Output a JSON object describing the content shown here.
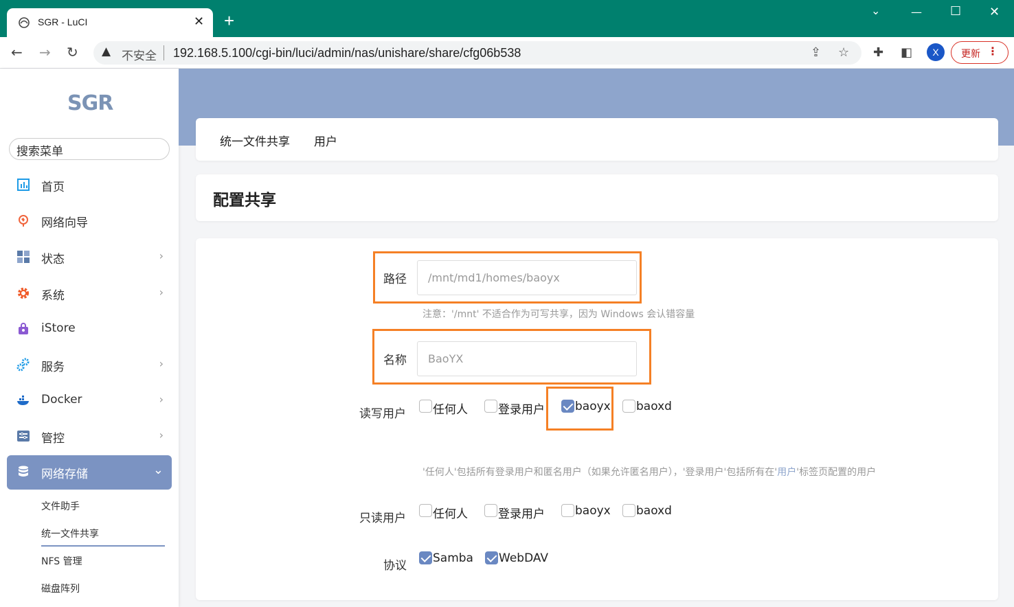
{
  "browser": {
    "tab_title": "SGR - LuCI",
    "insecure_label": "不安全",
    "url": "192.168.5.100/cgi-bin/luci/admin/nas/unishare/share/cfg06b538",
    "profile_initial": "X",
    "update_label": "更新"
  },
  "sidebar": {
    "logo": "SGR",
    "search_placeholder": "搜索菜单",
    "items": [
      {
        "label": "首页",
        "icon": "dashboard-icon",
        "color": "#1e9be6"
      },
      {
        "label": "网络向导",
        "icon": "globe-icon",
        "color": "#f0643c"
      },
      {
        "label": "状态",
        "icon": "status-grid-icon",
        "color": "#5a7aa8"
      },
      {
        "label": "系统",
        "icon": "gear-icon",
        "color": "#f05a28"
      },
      {
        "label": "iStore",
        "icon": "store-bag-icon",
        "color": "#8b5ad2"
      },
      {
        "label": "服务",
        "icon": "services-gears-icon",
        "color": "#1e9be6"
      },
      {
        "label": "Docker",
        "icon": "docker-whale-icon",
        "color": "#1e6bc8"
      },
      {
        "label": "管控",
        "icon": "control-panel-icon",
        "color": "#5a7aa8"
      },
      {
        "label": "网络存储",
        "icon": "storage-db-icon",
        "color": "#ffffff"
      }
    ],
    "sub_items": [
      "文件助手",
      "统一文件共享",
      "NFS 管理",
      "磁盘阵列"
    ]
  },
  "main": {
    "tabs": [
      "统一文件共享",
      "用户"
    ],
    "page_title": "配置共享",
    "form": {
      "path_label": "路径",
      "path_value": "/mnt/md1/homes/baoyx",
      "path_note": "注意：'/mnt' 不适合作为可写共享，因为 Windows 会认错容量",
      "name_label": "名称",
      "name_value": "BaoYX",
      "rw_label": "读写用户",
      "rw_options": [
        {
          "label": "任何人",
          "checked": false
        },
        {
          "label": "登录用户",
          "checked": false
        },
        {
          "label": "baoyx",
          "checked": true
        },
        {
          "label": "baoxd",
          "checked": false
        }
      ],
      "users_note_a": "'任何人'包括所有登录用户和匿名用户（如果允许匿名用户），'登录用户'包括所有在'",
      "users_note_link": "用户",
      "users_note_b": "'标签页配置的用户",
      "ro_label": "只读用户",
      "ro_options": [
        {
          "label": "任何人",
          "checked": false
        },
        {
          "label": "登录用户",
          "checked": false
        },
        {
          "label": "baoyx",
          "checked": false
        },
        {
          "label": "baoxd",
          "checked": false
        }
      ],
      "proto_label": "协议",
      "proto_options": [
        {
          "label": "Samba",
          "checked": true
        },
        {
          "label": "WebDAV",
          "checked": true
        }
      ]
    }
  },
  "colors": {
    "titlebar": "#00806e",
    "accent": "#7b93c2",
    "highlight": "#f58025"
  }
}
